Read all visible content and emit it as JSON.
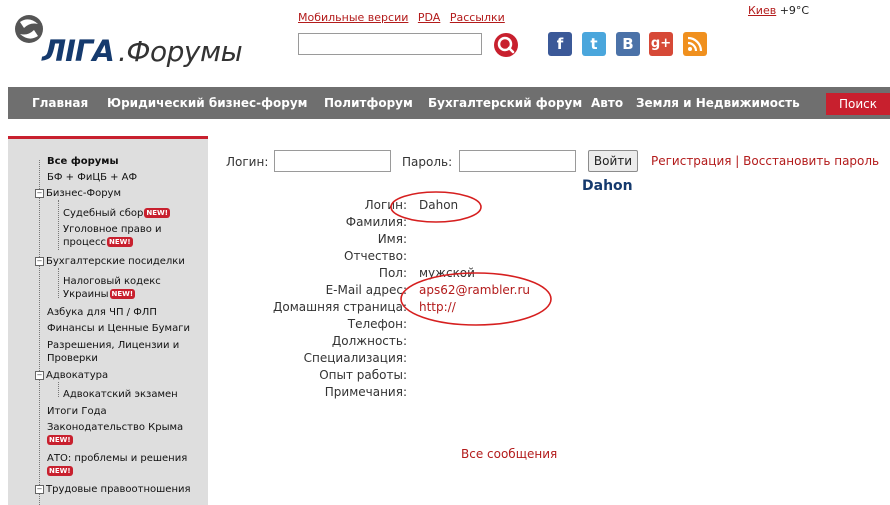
{
  "logo": {
    "brand": "ЛIГА",
    "suffix": ".Форумы"
  },
  "top_links": [
    "Мобильные версии",
    "PDA",
    "Рассылки"
  ],
  "weather": {
    "city": "Киев",
    "temp": "+9°C"
  },
  "social": {
    "facebook": "f",
    "twitter": "t",
    "vkontakte": "B",
    "googleplus": "g+",
    "rss": "rss"
  },
  "nav": {
    "items": [
      "Главная",
      "Юридический бизнес-форум",
      "Политфорум",
      "Бухгалтерский форум",
      "Авто",
      "Земля и Недвижимость"
    ],
    "search_label": "Поиск"
  },
  "sidebar": {
    "new_badge": "NEW!",
    "items": [
      "Все форумы",
      "БФ + ФиЦБ + АФ",
      "Бизнес-Форум",
      "Судебный сбор",
      "Уголовное право и",
      "процесс",
      "Бухгалтерские посиделки",
      "Налоговый кодекс",
      "Украины",
      "Азбука для ЧП / ФЛП",
      "Финансы и Ценные Бумаги",
      "Разрешения, Лицензии и",
      "Проверки",
      "Адвокатура",
      "Адвокатский экзамен",
      "Итоги Года",
      "Законодательство Крыма",
      "АТО: проблемы и решения",
      "Трудовые правоотношения"
    ]
  },
  "login": {
    "login_label": "Логин:",
    "password_label": "Пароль:",
    "login_value": "",
    "password_value": "",
    "submit": "Войти",
    "register": "Регистрация",
    "separator": "|",
    "restore": "Восстановить пароль"
  },
  "profile": {
    "name": "Dahon",
    "fields": [
      {
        "label": "Логин:",
        "value": "Dahon"
      },
      {
        "label": "Фамилия:",
        "value": ""
      },
      {
        "label": "Имя:",
        "value": ""
      },
      {
        "label": "Отчество:",
        "value": ""
      },
      {
        "label": "Пол:",
        "value": "мужской"
      },
      {
        "label": "E-Mail адрес:",
        "value": "aps62@rambler.ru"
      },
      {
        "label": "Домашняя страница:",
        "value": "http://"
      },
      {
        "label": "Телефон:",
        "value": ""
      },
      {
        "label": "Должность:",
        "value": ""
      },
      {
        "label": "Специализация:",
        "value": ""
      },
      {
        "label": "Опыт работы:",
        "value": ""
      },
      {
        "label": "Примечания:",
        "value": ""
      }
    ],
    "all_messages": "Все сообщения"
  },
  "colors": {
    "accent": "#c8202e",
    "brand": "#153a6e",
    "navbar": "#6f6f6f",
    "sidebar": "#dedede",
    "link": "#b31b1b"
  }
}
